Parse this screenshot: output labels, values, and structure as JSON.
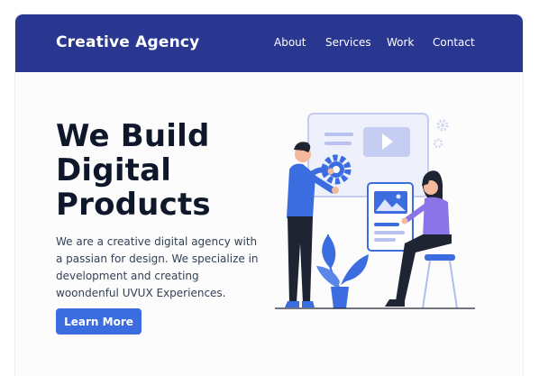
{
  "navbar": {
    "brand": "Creative Agency",
    "links": [
      "About",
      "Services",
      "Work",
      "Contact"
    ]
  },
  "hero": {
    "title_lines": [
      "We Build",
      "Digital",
      "Products"
    ],
    "description": "We are a creative digital agency with a passian for design. We specialize in development and creating woondenful UVUX Experiences.",
    "cta_label": "Learn More"
  },
  "colors": {
    "navbar": "#2a3790",
    "accent": "#3b6de0",
    "title": "#0f172a"
  },
  "illustration": {
    "icons": [
      "play-icon",
      "gear-icon",
      "image-icon",
      "plant-icon"
    ]
  }
}
